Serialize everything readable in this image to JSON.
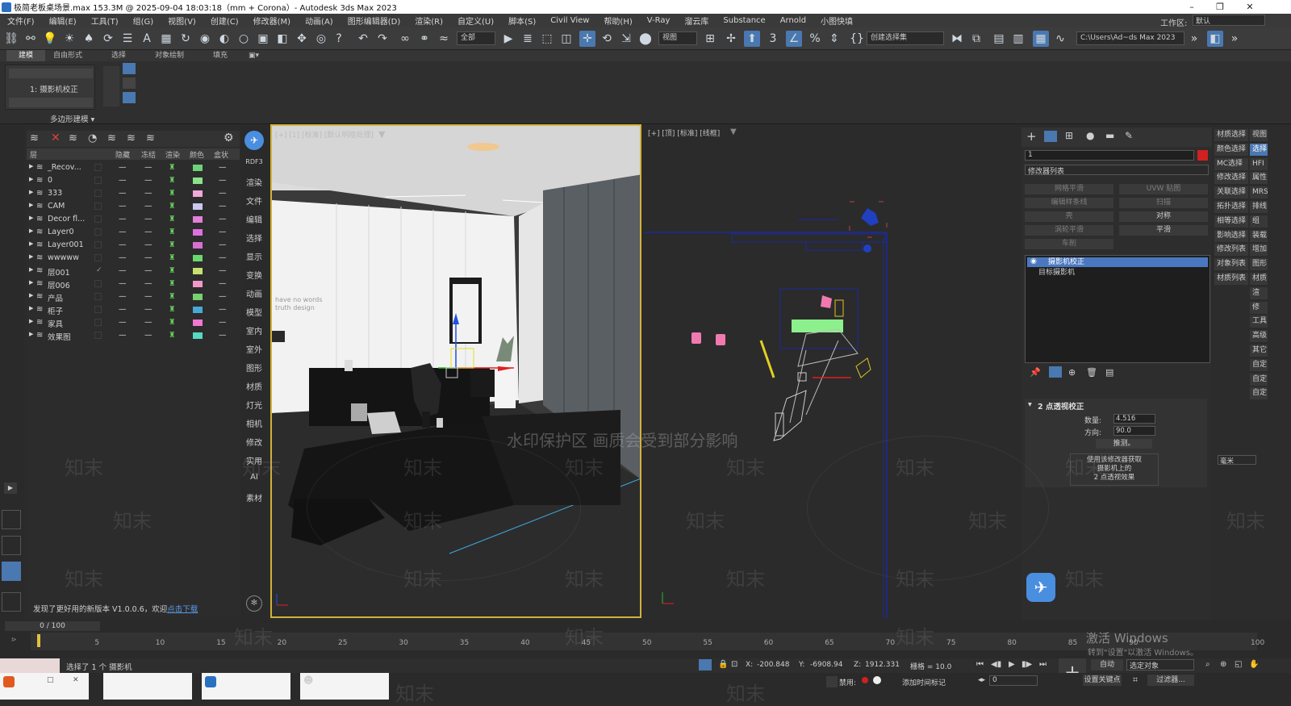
{
  "titlebar": {
    "title": "极简老板桌场景.max  153.3M @ 2025-09-04 18:03:18（mm + Corona）- Autodesk 3ds Max 2023",
    "min": "–",
    "max": "❐",
    "close": "✕"
  },
  "menubar": {
    "items": [
      "文件(F)",
      "编辑(E)",
      "工具(T)",
      "组(G)",
      "视图(V)",
      "创建(C)",
      "修改器(M)",
      "动画(A)",
      "图形编辑器(D)",
      "渲染(R)",
      "自定义(U)",
      "脚本(S)",
      "Civil View",
      "帮助(H)",
      "V-Ray",
      "溜云库",
      "Substance",
      "Arnold",
      "小图快填"
    ],
    "workspace_label": "工作区:",
    "workspace_value": "默认"
  },
  "toolbar": {
    "selection_filter": "全部",
    "ref_coord": "视图",
    "named_sel": "创建选择集",
    "path": "C:\\Users\\Ad~ds Max 2023"
  },
  "ribbon": {
    "tabs": [
      "建模",
      "自由形式",
      "选择",
      "对象绘制",
      "填充"
    ],
    "panel_label": "1: 摄影机校正",
    "group_label": "多边形建模 ▾"
  },
  "layers": {
    "headers": {
      "name": "层",
      "hide": "隐藏",
      "freeze": "冻结",
      "render": "渲染",
      "color": "颜色",
      "box": "盒状"
    },
    "rows": [
      {
        "name": "_Recov...",
        "color": "#6fd27a"
      },
      {
        "name": "0",
        "color": "#8de08a"
      },
      {
        "name": "333",
        "color": "#f0a8d8"
      },
      {
        "name": "CAM",
        "color": "#c8c8f0"
      },
      {
        "name": "Decor fl...",
        "color": "#e080d8"
      },
      {
        "name": "Layer0",
        "color": "#e070e0"
      },
      {
        "name": "Layer001",
        "color": "#d870d0"
      },
      {
        "name": "wwwww",
        "color": "#6ad870"
      },
      {
        "name": "层001",
        "color": "#c8e070",
        "check": "✓"
      },
      {
        "name": "层006",
        "color": "#f098c8"
      },
      {
        "name": "产品",
        "color": "#78d070"
      },
      {
        "name": "柜子",
        "color": "#4aa8d8"
      },
      {
        "name": "家具",
        "color": "#f078d0"
      },
      {
        "name": "效果图",
        "color": "#58d8c0"
      }
    ],
    "dash": "—",
    "footer": "发现了更好用的新版本 V1.0.0.6，欢迎",
    "footer_link": "点击下载"
  },
  "cmdstrip": {
    "top": "RDF3",
    "items": [
      "渲染",
      "文件",
      "编辑",
      "选择",
      "显示",
      "变换",
      "动画",
      "模型",
      "室内",
      "室外",
      "图形",
      "材质",
      "灯光",
      "相机",
      "修改",
      "实用",
      "AI",
      "素材"
    ]
  },
  "viewport1": {
    "label": "[+] [1] [标准] [默认明暗处理]",
    "wall_text_1": "have no words",
    "wall_text_2": "truth design"
  },
  "viewport2": {
    "label": "[+] [顶] [标准] [线框]"
  },
  "modify": {
    "object_name": "1",
    "modifier_list": "修改器列表",
    "buttons": [
      "网格平滑",
      "UVW 贴图",
      "编辑样条线",
      "扫描",
      "壳",
      "对称",
      "涡轮平滑",
      "平滑",
      "车削"
    ],
    "stack": [
      "摄影机校正",
      "目标摄影机"
    ],
    "rollout_title": "2 点透视校正",
    "amount_label": "数量:",
    "amount_value": "4.516",
    "direction_label": "方向:",
    "direction_value": "90.0",
    "guess_button": "推测。",
    "note_1": "使用该修改器获取",
    "note_2": "摄影机上的",
    "note_3": "2 点透视效果"
  },
  "farright": {
    "col1": [
      "材质选择",
      "颜色选择",
      "MC选择",
      "修改选择",
      "关联选择",
      "拓扑选择",
      "相等选择",
      "影响选择",
      "修改列表",
      "对象列表",
      "材质列表"
    ],
    "col2": [
      "视图",
      "选择",
      "HFI",
      "属性",
      "MRS",
      "排线",
      "组",
      "装载",
      "增加",
      "图形",
      "材质",
      "渲",
      "修",
      "工具",
      "高级",
      "其它",
      "自定",
      "自定",
      "自定"
    ],
    "units": "毫米"
  },
  "timeline": {
    "frame_display": "0 / 100",
    "ticks": [
      "5",
      "10",
      "15",
      "20",
      "25",
      "30",
      "35",
      "40",
      "45",
      "50",
      "55",
      "60",
      "65",
      "70",
      "75",
      "80",
      "85",
      "90",
      "100"
    ]
  },
  "statusbar": {
    "selection": "选择了 1 个 摄影机",
    "x_label": "X:",
    "x": "-200.848",
    "y_label": "Y:",
    "y": "-6908.94",
    "z_label": "Z:",
    "z": "1912.331",
    "grid": "栅格 = 10.0",
    "auto": "自动",
    "sel_obj": "选定对象",
    "set_key": "设置关键点",
    "filters": "过滤器...",
    "disabled": "禁用:",
    "add_tag": "添加时间标记",
    "frame": "0"
  },
  "watermark": {
    "center": "水印保护区   画质会受到部分影响",
    "logo": "知末",
    "activate_1": "激活 Windows",
    "activate_2": "转到\"设置\"以激活 Windows。"
  }
}
